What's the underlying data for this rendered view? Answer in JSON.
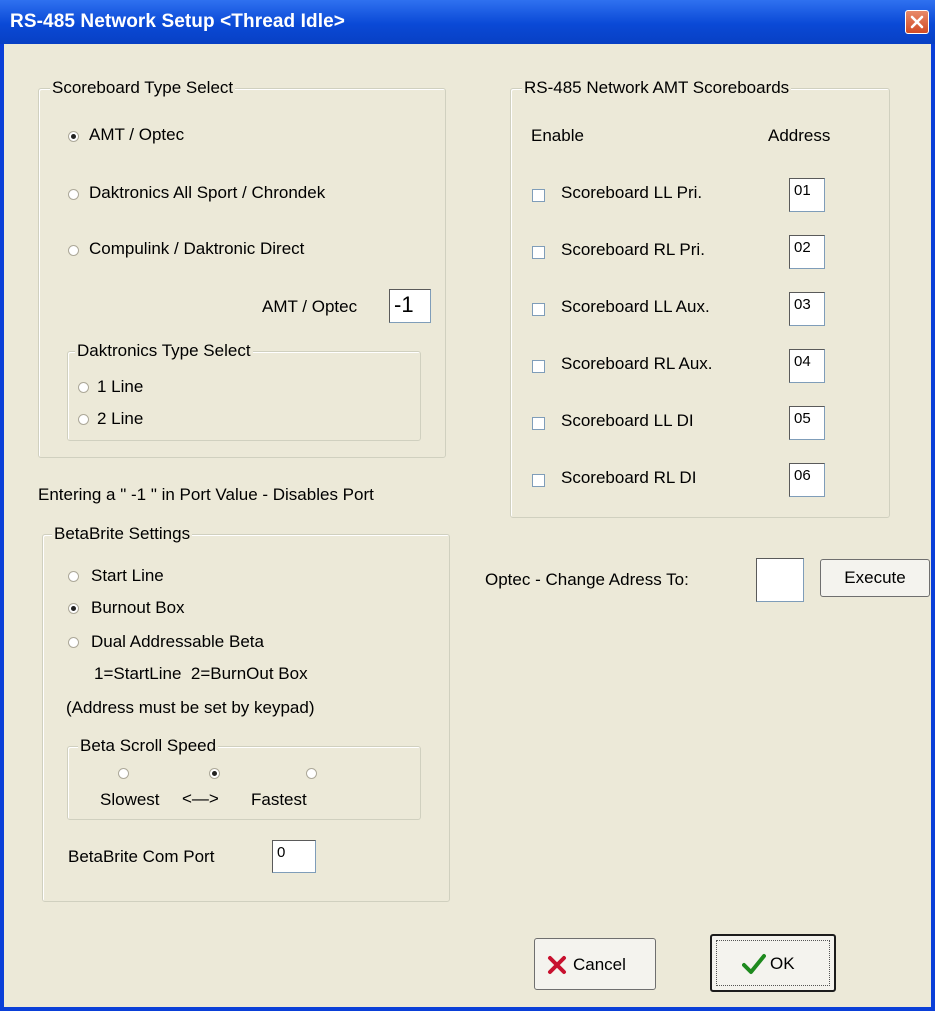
{
  "window": {
    "title": "RS-485 Network Setup <Thread Idle>"
  },
  "scoreboard_type": {
    "legend": "Scoreboard Type Select",
    "options": [
      {
        "label": "AMT / Optec",
        "selected": true
      },
      {
        "label": "Daktronics All Sport / Chrondek",
        "selected": false
      },
      {
        "label": "Compulink / Daktronic Direct",
        "selected": false
      }
    ],
    "amt_optec_label": "AMT / Optec",
    "amt_optec_value": "-1",
    "daktronics": {
      "legend": "Daktronics Type Select",
      "options": [
        {
          "label": "1 Line",
          "selected": false
        },
        {
          "label": "2 Line",
          "selected": false
        }
      ]
    }
  },
  "port_note": "Entering a \" -1 \" in Port Value - Disables Port",
  "betabrite": {
    "legend": "BetaBrite Settings",
    "options": [
      {
        "label": "Start Line",
        "selected": false
      },
      {
        "label": "Burnout Box",
        "selected": true
      },
      {
        "label": "Dual Addressable Beta",
        "selected": false
      }
    ],
    "note1": "1=StartLine  2=BurnOut Box",
    "note2": "(Address must be set by keypad)",
    "scroll_speed": {
      "legend": "Beta Scroll Speed",
      "selected_index": 1,
      "slowest": "Slowest",
      "arrow": "<—>",
      "fastest": "Fastest"
    },
    "com_port_label": "BetaBrite Com Port",
    "com_port_value": "0"
  },
  "network": {
    "legend": "RS-485 Network AMT Scoreboards",
    "enable_header": "Enable",
    "address_header": "Address",
    "rows": [
      {
        "label": "Scoreboard LL Pri.",
        "address": "01",
        "enabled": false
      },
      {
        "label": "Scoreboard RL Pri.",
        "address": "02",
        "enabled": false
      },
      {
        "label": "Scoreboard LL Aux.",
        "address": "03",
        "enabled": false
      },
      {
        "label": "Scoreboard RL Aux.",
        "address": "04",
        "enabled": false
      },
      {
        "label": "Scoreboard LL DI",
        "address": "05",
        "enabled": false
      },
      {
        "label": "Scoreboard RL DI",
        "address": "06",
        "enabled": false
      }
    ]
  },
  "optec": {
    "label": "Optec - Change Adress To:",
    "value": "",
    "execute_label": "Execute"
  },
  "buttons": {
    "cancel_label": "Cancel",
    "ok_label": "OK"
  },
  "colors": {
    "titlebar": "#0a49d6",
    "dialog_bg": "#ece9d8",
    "cancel_icon": "#c8102e",
    "ok_icon": "#1e8a1e"
  }
}
